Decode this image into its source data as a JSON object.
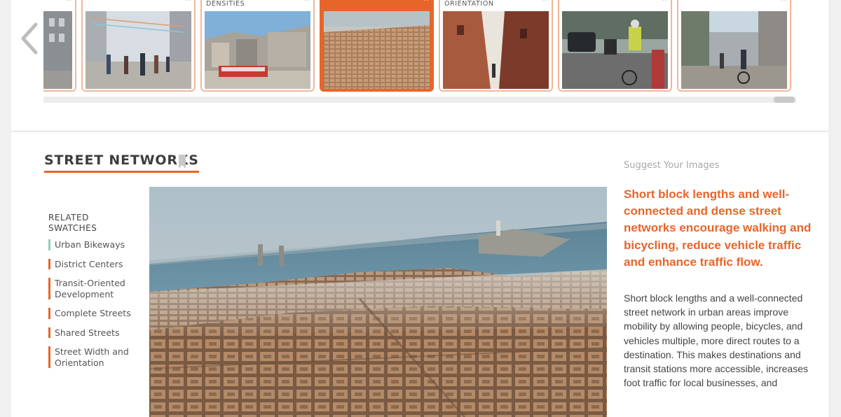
{
  "carousel": {
    "thumbnails": [
      {
        "caption": "",
        "image": "street-buildings-photo",
        "active": false
      },
      {
        "caption": "",
        "image": "pedestrian-street-photo",
        "active": false
      },
      {
        "caption": "Densities",
        "image": "waterfront-tram-photo",
        "active": false
      },
      {
        "caption": "",
        "image": "aerial-city-photo",
        "active": true
      },
      {
        "caption": "Orientation",
        "image": "narrow-alley-photo",
        "active": false
      },
      {
        "caption": "",
        "image": "bike-lane-cyclist-photo",
        "active": false
      },
      {
        "caption": "",
        "image": "street-cyclists-photo",
        "active": false
      }
    ]
  },
  "section": {
    "title": "STREET NETWORKS",
    "related": {
      "heading": "Related Swatches",
      "items": [
        {
          "label": "Urban Bikeways",
          "accent": "#8fcfbe"
        },
        {
          "label": "District Centers",
          "accent": "#e8652a"
        },
        {
          "label": "Transit-Oriented Development",
          "accent": "#e8652a"
        },
        {
          "label": "Complete Streets",
          "accent": "#e8652a"
        },
        {
          "label": "Shared Streets",
          "accent": "#e8652a"
        },
        {
          "label": "Street Width and Orientation",
          "accent": "#e8652a"
        }
      ]
    },
    "main_image": "aerial-barcelona-street-grid-photo",
    "suggest_link": "Suggest Your Images",
    "headline": "Short block lengths and well-connected and dense street networks encourage walking and bicycling, reduce vehicle traffic and enhance traffic flow.",
    "body": "Short block lengths and a well-connected street network in urban areas improve mobility by allowing people, bicycles, and vehicles multiple, more direct routes to a destination. This makes destinations and transit stations more accessible, increases foot traffic for local businesses, and"
  },
  "colors": {
    "accent": "#e8652a",
    "teal": "#8fcfbe",
    "text": "#444444"
  }
}
